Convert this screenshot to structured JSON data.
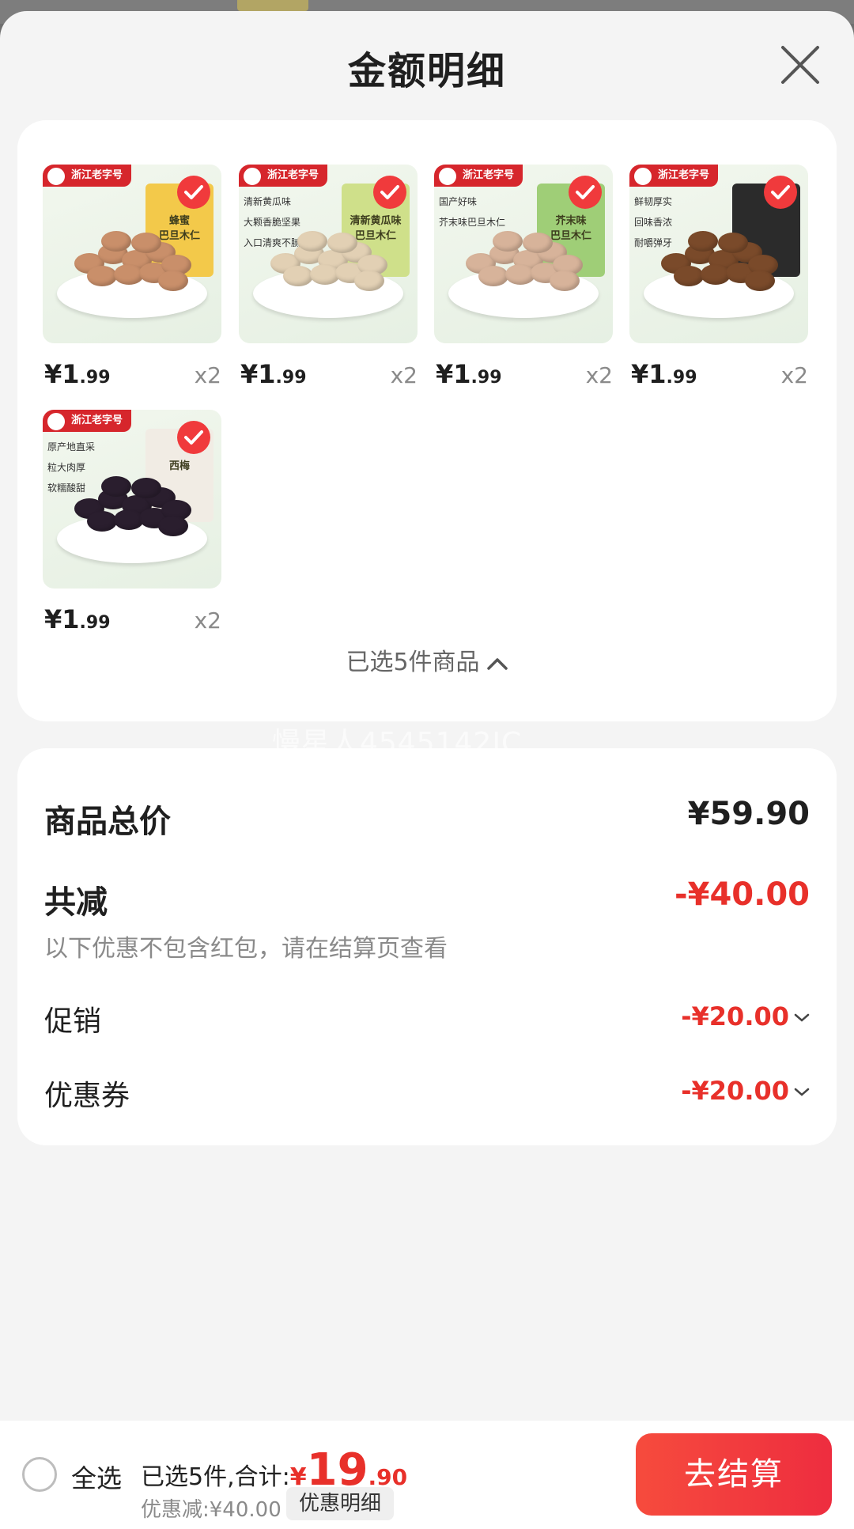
{
  "sheet": {
    "title": "金额明细"
  },
  "products": [
    {
      "brand": "浙江老字号",
      "pack_label": "蜂蜜\n巴旦木仁",
      "tags": [],
      "price_int": "¥1",
      "price_dec": ".99",
      "qty": "x2",
      "checked": true,
      "pack_color": "#f3c94a",
      "nut_color": "#c98f6a"
    },
    {
      "brand": "浙江老字号",
      "pack_label": "清新黄瓜味\n巴旦木仁",
      "tags": [
        "清新黄瓜味",
        "大颗香脆坚果",
        "入口清爽不腻"
      ],
      "price_int": "¥1",
      "price_dec": ".99",
      "qty": "x2",
      "checked": true,
      "pack_color": "#cfe08a",
      "nut_color": "#e2d0b4"
    },
    {
      "brand": "浙江老字号",
      "pack_label": "芥末味\n巴旦木仁",
      "tags": [
        "国产好味",
        "芥末味巴旦木仁"
      ],
      "price_int": "¥1",
      "price_dec": ".99",
      "qty": "x2",
      "checked": true,
      "pack_color": "#9fce77",
      "nut_color": "#d7b39a"
    },
    {
      "brand": "浙江老字号",
      "pack_label": "",
      "tags": [
        "鲜韧厚实",
        "回味香浓",
        "耐嚼弹牙"
      ],
      "price_int": "¥1",
      "price_dec": ".99",
      "qty": "x2",
      "checked": true,
      "pack_color": "#2b2b2b",
      "nut_color": "#7a4a2a"
    },
    {
      "brand": "浙江老字号",
      "pack_label": "西梅",
      "tags": [
        "原产地直采",
        "粒大肉厚",
        "软糯酸甜"
      ],
      "price_int": "¥1",
      "price_dec": ".99",
      "qty": "x2",
      "checked": true,
      "pack_color": "#f1ece4",
      "nut_color": "#2a1e2e"
    }
  ],
  "selected_toggle": {
    "label": "已选5件商品"
  },
  "watermark": "慢星人4545142IC",
  "summary": {
    "total_label": "商品总价",
    "total_value": "¥59.90",
    "reduce_label": "共减",
    "reduce_value": "-¥40.00",
    "note": "以下优惠不包含红包，请在结算页查看",
    "promo_label": "促销",
    "promo_value": "-¥20.00",
    "coupon_label": "优惠券",
    "coupon_value": "-¥20.00"
  },
  "footer": {
    "select_all": "全选",
    "total_prefix": "已选5件,合计:",
    "currency": "¥",
    "amount_int": "19",
    "amount_dec": ".90",
    "discount": "优惠减:¥40.00",
    "detail_button": "优惠明细",
    "checkout_button": "去结算"
  },
  "colors": {
    "accent_red": "#e8302a",
    "checkout_gradient_start": "#f64b3d",
    "checkout_gradient_end": "#ee2d3f"
  }
}
